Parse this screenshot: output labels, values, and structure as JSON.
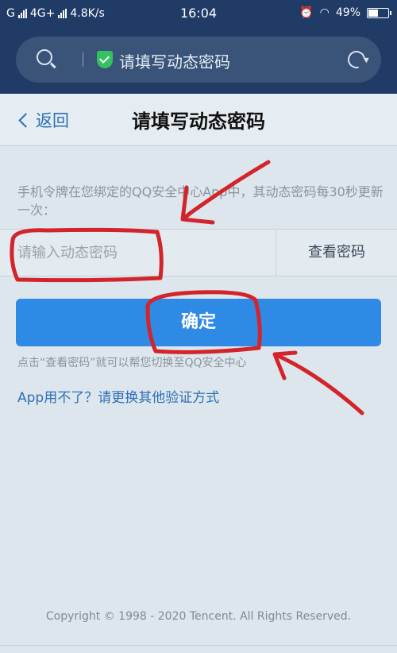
{
  "status_bar": {
    "carrier": "G",
    "network": "4G+",
    "speed": "4.8K/s",
    "time": "16:04",
    "battery": "49%"
  },
  "browser": {
    "page_title": "请填写动态密码"
  },
  "nav": {
    "back_label": "返回",
    "title": "请填写动态密码"
  },
  "form": {
    "description": "手机令牌在您绑定的QQ安全中心App中，其动态密码每30秒更新一次：",
    "input_placeholder": "请输入动态密码",
    "input_value": "",
    "view_code_label": "查看密码",
    "confirm_label": "确定",
    "hint": "点击“查看密码”就可以帮您切换至QQ安全中心",
    "alt_link": "App用不了？请更换其他验证方式"
  },
  "footer": {
    "copyright": "Copyright © 1998 - 2020 Tencent. All Rights Reserved."
  },
  "colors": {
    "header_bg": "#1f3b66",
    "accent": "#2f8ae6",
    "link": "#2d6fb8",
    "annotation": "#d3242c"
  }
}
